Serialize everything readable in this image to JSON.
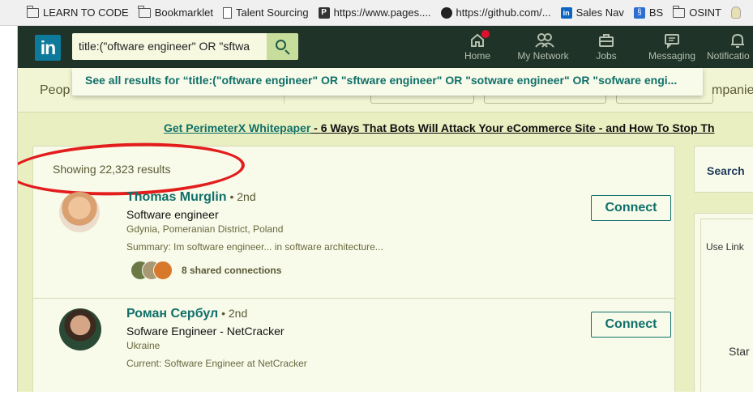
{
  "bookmarks": [
    {
      "label": "LEARN TO CODE",
      "icon": "folder-icon"
    },
    {
      "label": "Bookmarklet",
      "icon": "folder-icon"
    },
    {
      "label": "Talent Sourcing",
      "icon": "document-icon"
    },
    {
      "label": "https://www.pages....",
      "icon": "pages-icon"
    },
    {
      "label": "https://github.com/...",
      "icon": "github-icon"
    },
    {
      "label": "Sales Nav",
      "icon": "linkedin-icon"
    },
    {
      "label": "BS",
      "icon": "bs-icon"
    },
    {
      "label": "OSINT",
      "icon": "folder-icon"
    }
  ],
  "header": {
    "logo_text": "in",
    "search_value": "title:(\"oftware engineer\" OR \"sftwa",
    "nav": [
      {
        "label": "Home",
        "icon": "home-icon",
        "badge": true
      },
      {
        "label": "My Network",
        "icon": "network-icon"
      },
      {
        "label": "Jobs",
        "icon": "briefcase-icon"
      },
      {
        "label": "Messaging",
        "icon": "messaging-icon"
      },
      {
        "label": "Notificatio",
        "icon": "bell-icon"
      }
    ]
  },
  "dropdown": {
    "suggestion": "See all results for “title:(\"oftware engineer\" OR \"sftware engineer\" OR \"sotware engineer\" OR \"sofware engi..."
  },
  "subbar": {
    "people": "Peop",
    "companies": "mpanies"
  },
  "ad": {
    "link": "Get PerimeterX Whitepaper",
    "separator": " - ",
    "text": "6 Ways That Bots Will Attack Your eCommerce Site - and How To Stop Th"
  },
  "results": {
    "showing": "Showing 22,323 results",
    "people": [
      {
        "name": "Thomas Murglin",
        "degree": " • 2nd",
        "title": "Software engineer",
        "location": "Gdynia, Pomeranian District, Poland",
        "summary": "Summary: Im software engineer... in software architecture...",
        "shared": "8 shared connections",
        "connect": "Connect"
      },
      {
        "name": "Роман Сербул",
        "degree": " • 2nd",
        "title": "Sofware Engineer - NetCracker",
        "location": "Ukraine",
        "summary": "Current: Software Engineer at NetCracker",
        "connect": "Connect"
      }
    ]
  },
  "right": {
    "search_label": "Search",
    "use_link": "Use Link",
    "star": "Star"
  },
  "colors": {
    "navbar": "#1f3328",
    "accent": "#107069",
    "page_bg": "#e9efc0",
    "card_bg": "#f8faea",
    "annotation": "#e31c1c"
  }
}
